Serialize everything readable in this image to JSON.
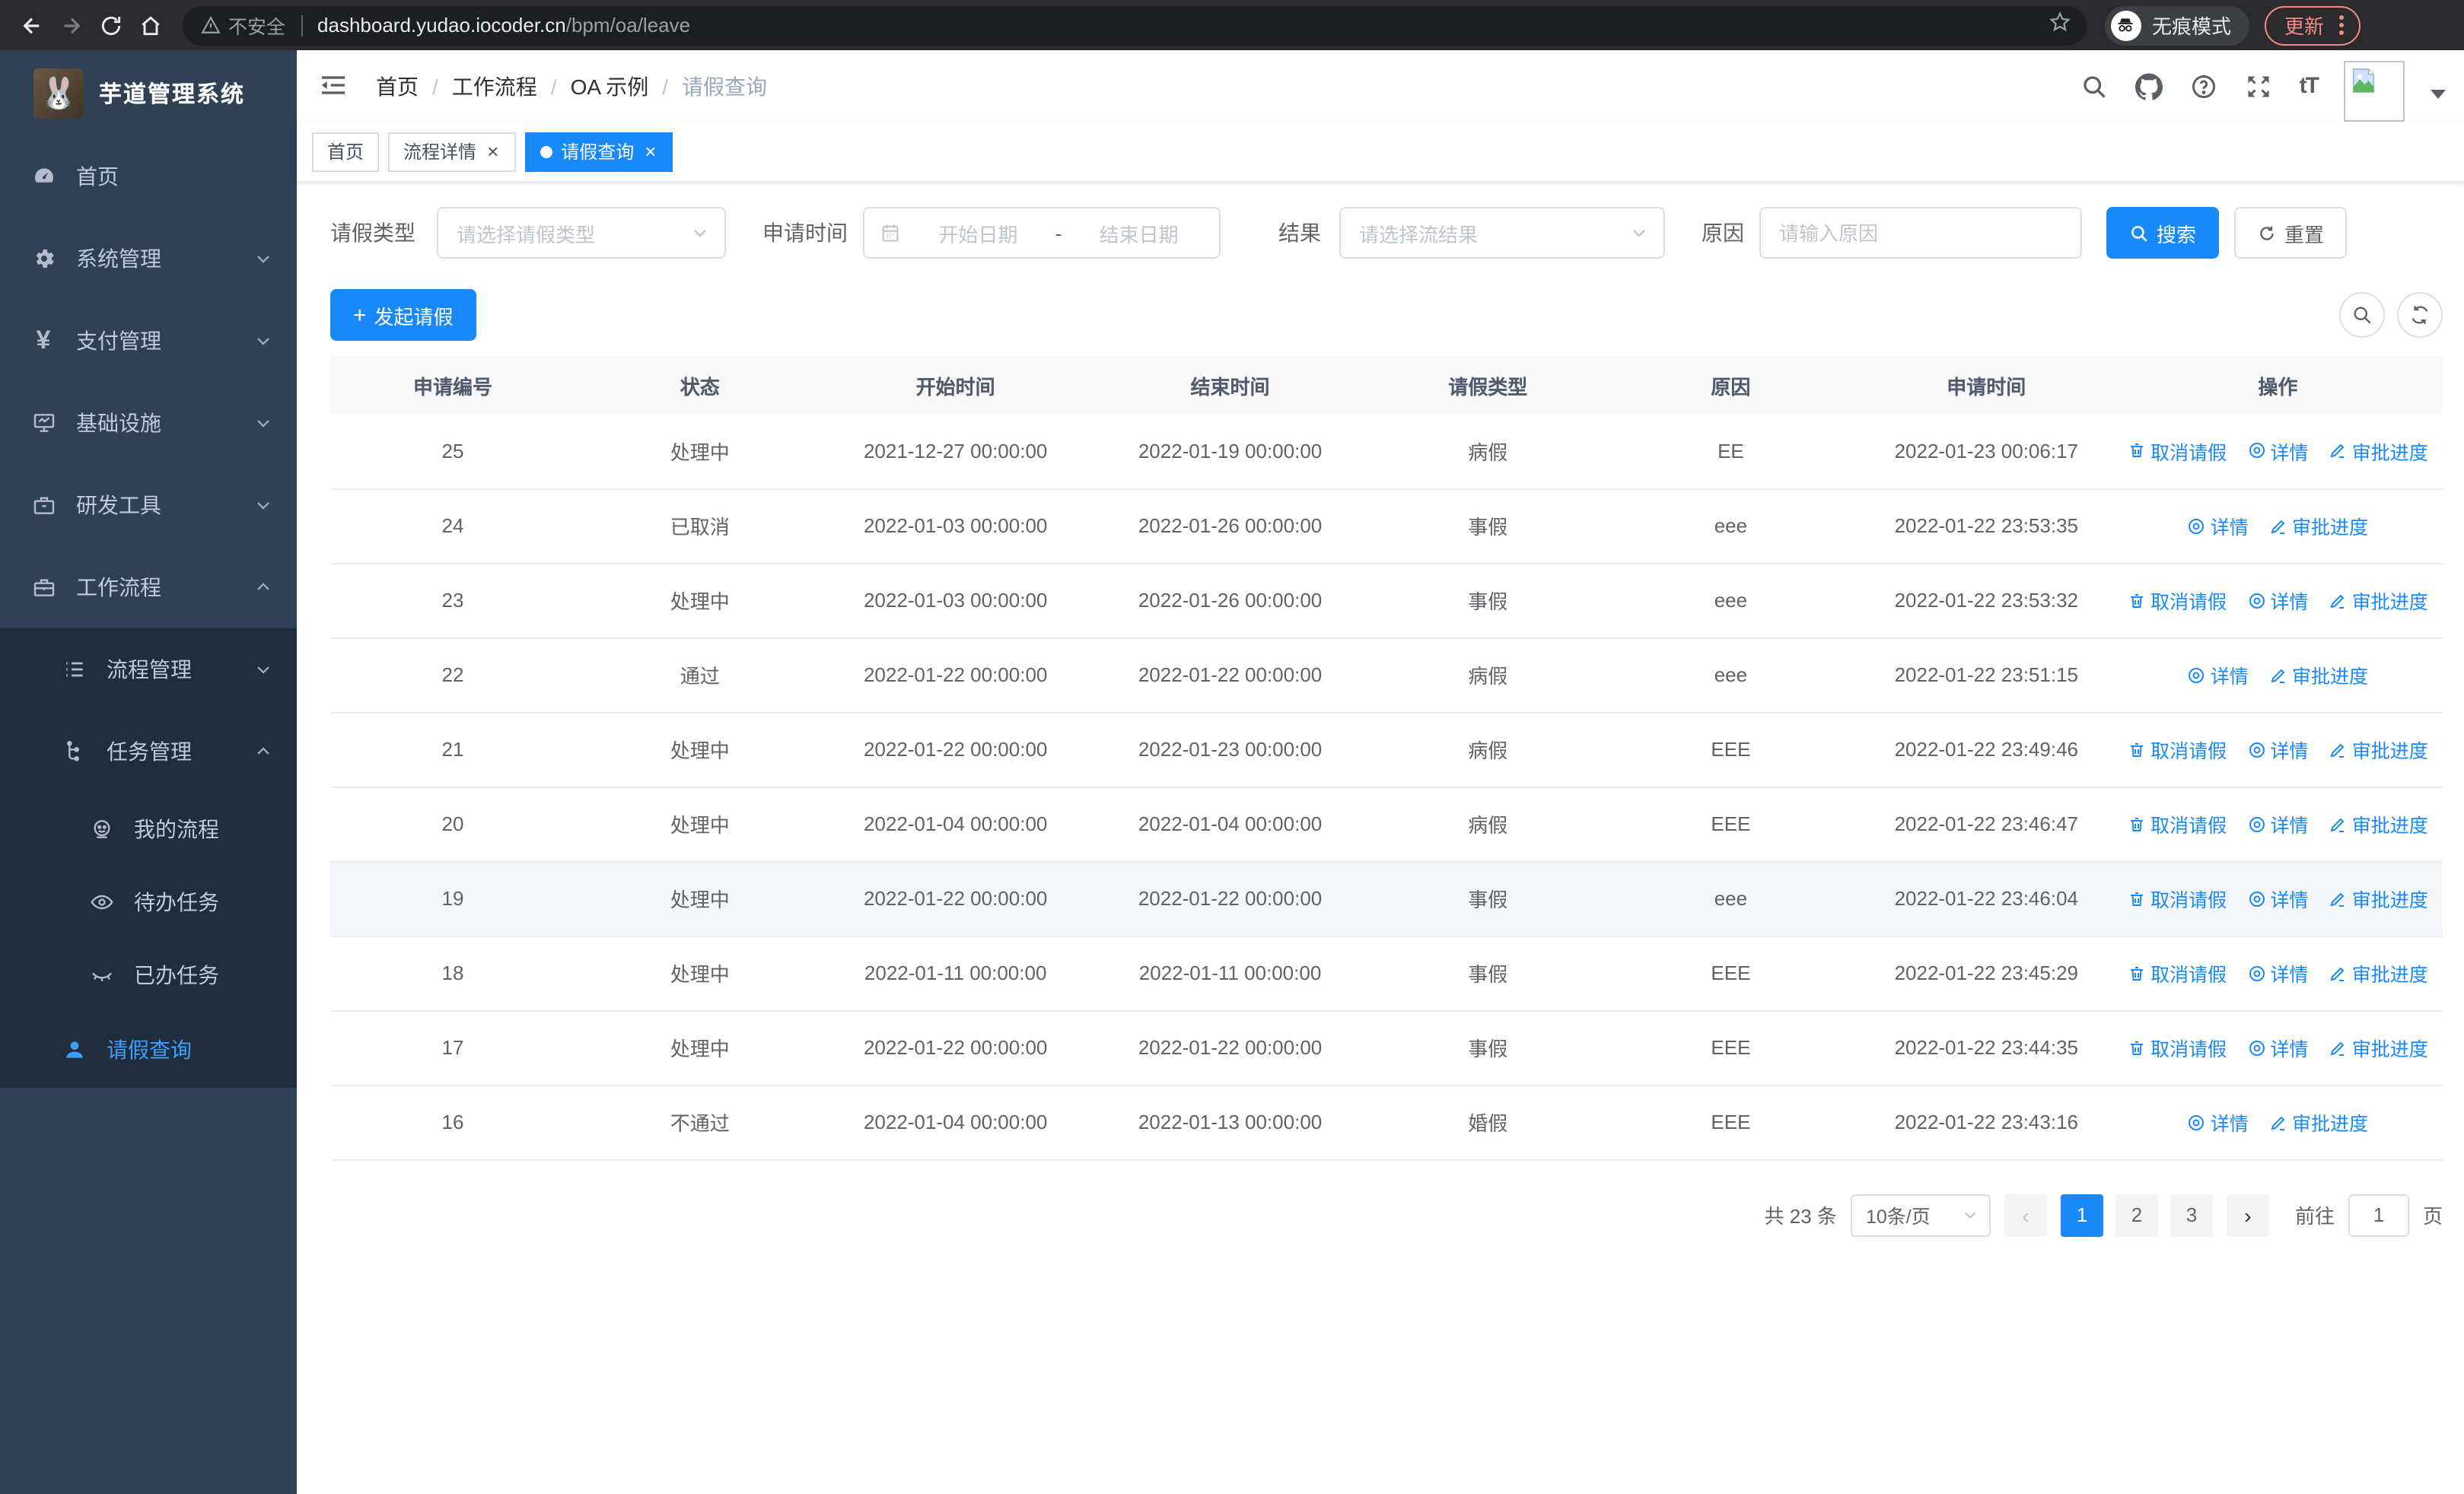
{
  "browser": {
    "security_label": "不安全",
    "url_host": "dashboard.yudao.iocoder.cn",
    "url_path": "/bpm/oa/leave",
    "incognito_label": "无痕模式",
    "update_label": "更新"
  },
  "sidebar": {
    "title": "芋道管理系统",
    "items": [
      {
        "label": "首页"
      },
      {
        "label": "系统管理"
      },
      {
        "label": "支付管理"
      },
      {
        "label": "基础设施"
      },
      {
        "label": "研发工具"
      },
      {
        "label": "工作流程"
      },
      {
        "label": "流程管理"
      },
      {
        "label": "任务管理"
      },
      {
        "label": "我的流程"
      },
      {
        "label": "待办任务"
      },
      {
        "label": "已办任务"
      },
      {
        "label": "请假查询"
      }
    ]
  },
  "breadcrumb": {
    "items": [
      "首页",
      "工作流程",
      "OA 示例",
      "请假查询"
    ],
    "separator": "/"
  },
  "tabs": [
    {
      "label": "首页"
    },
    {
      "label": "流程详情"
    },
    {
      "label": "请假查询"
    }
  ],
  "filters": {
    "leave_type_label": "请假类型",
    "leave_type_placeholder": "请选择请假类型",
    "apply_time_label": "申请时间",
    "start_placeholder": "开始日期",
    "range_separator": "-",
    "end_placeholder": "结束日期",
    "result_label": "结果",
    "result_placeholder": "请选择流结果",
    "reason_label": "原因",
    "reason_placeholder": "请输入原因",
    "search_label": "搜索",
    "reset_label": "重置"
  },
  "toolbar": {
    "create_label": "发起请假"
  },
  "table": {
    "columns": [
      "申请编号",
      "状态",
      "开始时间",
      "结束时间",
      "请假类型",
      "原因",
      "申请时间",
      "操作"
    ],
    "action_labels": {
      "cancel": "取消请假",
      "detail": "详情",
      "progress": "审批进度"
    },
    "rows": [
      {
        "id": "25",
        "status": "处理中",
        "start": "2021-12-27 00:00:00",
        "end": "2022-01-19 00:00:00",
        "type": "病假",
        "reason": "EE",
        "applied": "2022-01-23 00:06:17",
        "can_cancel": true,
        "highlight": false
      },
      {
        "id": "24",
        "status": "已取消",
        "start": "2022-01-03 00:00:00",
        "end": "2022-01-26 00:00:00",
        "type": "事假",
        "reason": "eee",
        "applied": "2022-01-22 23:53:35",
        "can_cancel": false,
        "highlight": false
      },
      {
        "id": "23",
        "status": "处理中",
        "start": "2022-01-03 00:00:00",
        "end": "2022-01-26 00:00:00",
        "type": "事假",
        "reason": "eee",
        "applied": "2022-01-22 23:53:32",
        "can_cancel": true,
        "highlight": false
      },
      {
        "id": "22",
        "status": "通过",
        "start": "2022-01-22 00:00:00",
        "end": "2022-01-22 00:00:00",
        "type": "病假",
        "reason": "eee",
        "applied": "2022-01-22 23:51:15",
        "can_cancel": false,
        "highlight": false
      },
      {
        "id": "21",
        "status": "处理中",
        "start": "2022-01-22 00:00:00",
        "end": "2022-01-23 00:00:00",
        "type": "病假",
        "reason": "EEE",
        "applied": "2022-01-22 23:49:46",
        "can_cancel": true,
        "highlight": false
      },
      {
        "id": "20",
        "status": "处理中",
        "start": "2022-01-04 00:00:00",
        "end": "2022-01-04 00:00:00",
        "type": "病假",
        "reason": "EEE",
        "applied": "2022-01-22 23:46:47",
        "can_cancel": true,
        "highlight": false
      },
      {
        "id": "19",
        "status": "处理中",
        "start": "2022-01-22 00:00:00",
        "end": "2022-01-22 00:00:00",
        "type": "事假",
        "reason": "eee",
        "applied": "2022-01-22 23:46:04",
        "can_cancel": true,
        "highlight": true
      },
      {
        "id": "18",
        "status": "处理中",
        "start": "2022-01-11 00:00:00",
        "end": "2022-01-11 00:00:00",
        "type": "事假",
        "reason": "EEE",
        "applied": "2022-01-22 23:45:29",
        "can_cancel": true,
        "highlight": false
      },
      {
        "id": "17",
        "status": "处理中",
        "start": "2022-01-22 00:00:00",
        "end": "2022-01-22 00:00:00",
        "type": "事假",
        "reason": "EEE",
        "applied": "2022-01-22 23:44:35",
        "can_cancel": true,
        "highlight": false
      },
      {
        "id": "16",
        "status": "不通过",
        "start": "2022-01-04 00:00:00",
        "end": "2022-01-13 00:00:00",
        "type": "婚假",
        "reason": "EEE",
        "applied": "2022-01-22 23:43:16",
        "can_cancel": false,
        "highlight": false
      }
    ]
  },
  "pagination": {
    "total_label": "共 23 条",
    "page_size_label": "10条/页",
    "pages": [
      "1",
      "2",
      "3"
    ],
    "active_page": "1",
    "goto_label": "前往",
    "goto_value": "1",
    "goto_unit": "页"
  },
  "colors": {
    "primary": "#1989fa",
    "sidebar_bg": "#304156",
    "submenu_bg": "#1f2d3d",
    "update_accent": "#f28b82"
  }
}
